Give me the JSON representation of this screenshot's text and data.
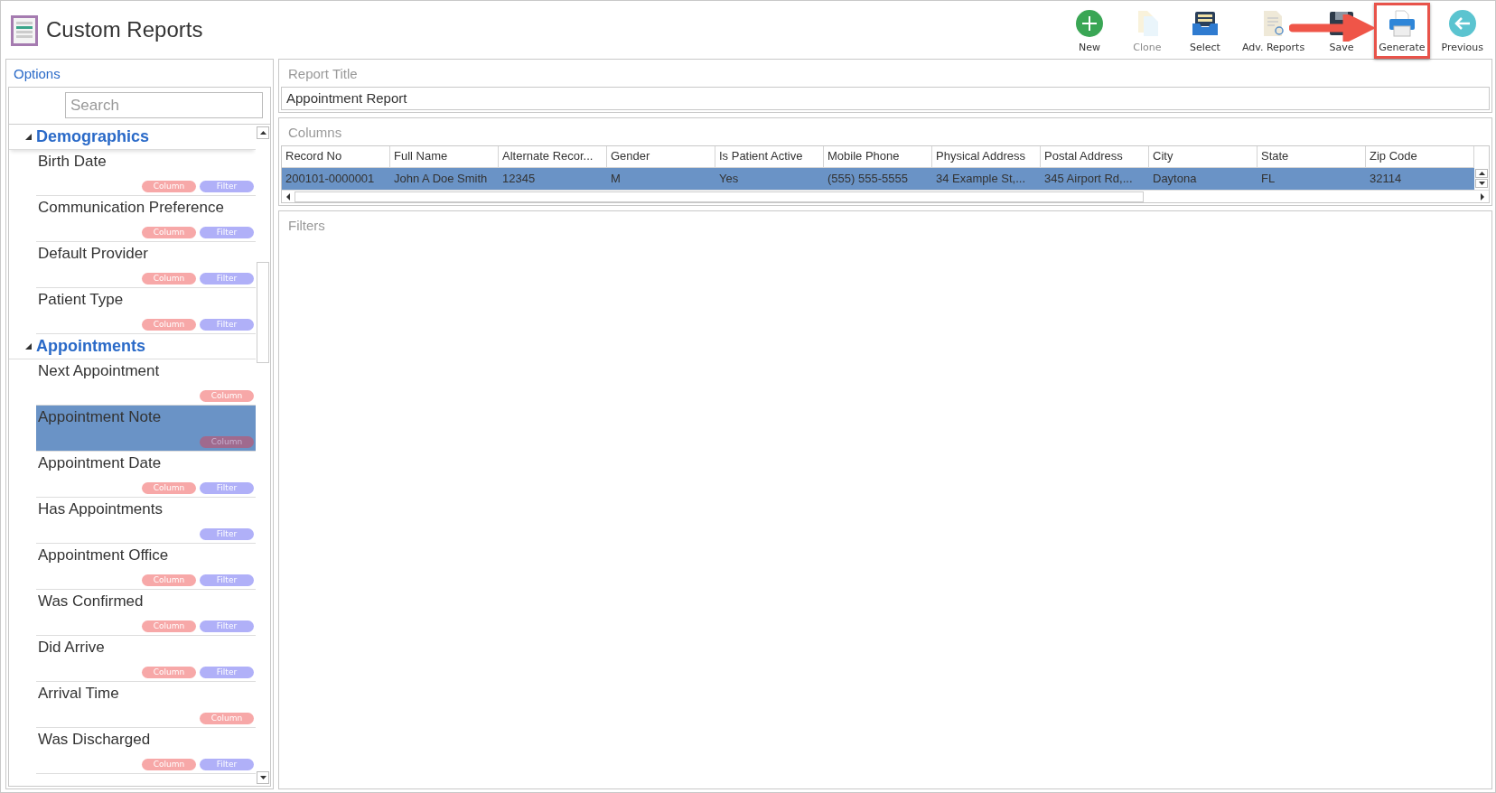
{
  "window": {
    "title": "Custom Reports"
  },
  "toolbar": [
    {
      "kind": "new",
      "label": "New",
      "disabled": false,
      "highlighted": false
    },
    {
      "kind": "clone",
      "label": "Clone",
      "disabled": true,
      "highlighted": false
    },
    {
      "kind": "select",
      "label": "Select",
      "disabled": false,
      "highlighted": false
    },
    {
      "kind": "adv",
      "label": "Adv. Reports",
      "disabled": false,
      "highlighted": false
    },
    {
      "kind": "save",
      "label": "Save",
      "disabled": false,
      "highlighted": false
    },
    {
      "kind": "generate",
      "label": "Generate",
      "disabled": false,
      "highlighted": true
    },
    {
      "kind": "previous",
      "label": "Previous",
      "disabled": false,
      "highlighted": false
    }
  ],
  "options": {
    "title": "Options",
    "search": {
      "placeholder": "Search"
    },
    "groups": [
      {
        "label": "Demographics",
        "expanded": true,
        "items": [
          {
            "label": "Birth Date",
            "selected": false,
            "tags": [
              {
                "kind": "column",
                "label": "Column"
              },
              {
                "kind": "filter",
                "label": "Filter"
              }
            ]
          },
          {
            "label": "Communication Preference",
            "selected": false,
            "tags": [
              {
                "kind": "column",
                "label": "Column"
              },
              {
                "kind": "filter",
                "label": "Filter"
              }
            ]
          },
          {
            "label": "Default Provider",
            "selected": false,
            "tags": [
              {
                "kind": "column",
                "label": "Column"
              },
              {
                "kind": "filter",
                "label": "Filter"
              }
            ]
          },
          {
            "label": "Patient Type",
            "selected": false,
            "tags": [
              {
                "kind": "column",
                "label": "Column"
              },
              {
                "kind": "filter",
                "label": "Filter"
              }
            ]
          }
        ]
      },
      {
        "label": "Appointments",
        "expanded": true,
        "items": [
          {
            "label": "Next Appointment",
            "selected": false,
            "tags": [
              {
                "kind": "column",
                "label": "Column"
              }
            ]
          },
          {
            "label": "Appointment Note",
            "selected": true,
            "tags": [
              {
                "kind": "column",
                "label": "Column"
              }
            ]
          },
          {
            "label": "Appointment Date",
            "selected": false,
            "tags": [
              {
                "kind": "column",
                "label": "Column"
              },
              {
                "kind": "filter",
                "label": "Filter"
              }
            ]
          },
          {
            "label": "Has Appointments",
            "selected": false,
            "tags": [
              {
                "kind": "filter",
                "label": "Filter"
              }
            ]
          },
          {
            "label": "Appointment Office",
            "selected": false,
            "tags": [
              {
                "kind": "column",
                "label": "Column"
              },
              {
                "kind": "filter",
                "label": "Filter"
              }
            ]
          },
          {
            "label": "Was Confirmed",
            "selected": false,
            "tags": [
              {
                "kind": "column",
                "label": "Column"
              },
              {
                "kind": "filter",
                "label": "Filter"
              }
            ]
          },
          {
            "label": "Did Arrive",
            "selected": false,
            "tags": [
              {
                "kind": "column",
                "label": "Column"
              },
              {
                "kind": "filter",
                "label": "Filter"
              }
            ]
          },
          {
            "label": "Arrival Time",
            "selected": false,
            "tags": [
              {
                "kind": "column",
                "label": "Column"
              }
            ]
          },
          {
            "label": "Was Discharged",
            "selected": false,
            "tags": [
              {
                "kind": "column",
                "label": "Column"
              },
              {
                "kind": "filter",
                "label": "Filter"
              }
            ]
          }
        ]
      }
    ]
  },
  "report_title": {
    "label": "Report Title",
    "value": "Appointment Report"
  },
  "columns": {
    "label": "Columns",
    "table": {
      "columns": [
        "Record No",
        "Full Name",
        "Alternate Recor...",
        "Gender",
        "Is Patient Active",
        "Mobile Phone",
        "Physical Address",
        "Postal Address",
        "City",
        "State",
        "Zip Code"
      ],
      "rows": [
        {
          "selected": true,
          "cells": [
            "200101-0000001",
            "John A Doe Smith",
            "12345",
            "M",
            "Yes",
            "(555) 555-5555",
            "34 Example St,...",
            "345 Airport Rd,...",
            "Daytona",
            "FL",
            "32114"
          ]
        }
      ]
    }
  },
  "filters": {
    "label": "Filters"
  }
}
